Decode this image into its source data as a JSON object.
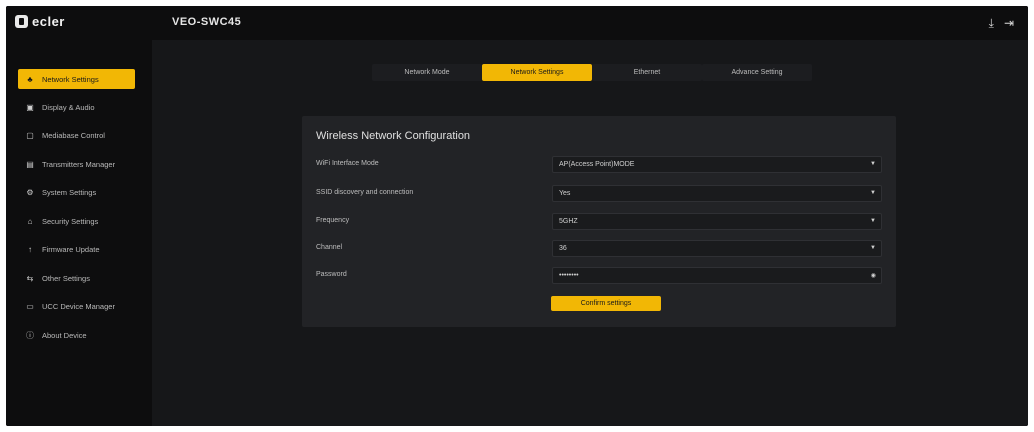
{
  "brand": {
    "logo_text": "ecler"
  },
  "header": {
    "device_name": "VEO-SWC45",
    "icons": [
      "download-icon",
      "logout-icon"
    ]
  },
  "sidebar": {
    "items": [
      {
        "label": "Network Settings",
        "icon": "network-icon"
      },
      {
        "label": "Display & Audio",
        "icon": "display-icon"
      },
      {
        "label": "Mediabase Control",
        "icon": "monitor-icon"
      },
      {
        "label": "Transmitters Manager",
        "icon": "transmitter-icon"
      },
      {
        "label": "System Settings",
        "icon": "gear-icon"
      },
      {
        "label": "Security Settings",
        "icon": "lock-icon"
      },
      {
        "label": "Firmware Update",
        "icon": "upload-icon"
      },
      {
        "label": "Other Settings",
        "icon": "sliders-icon"
      },
      {
        "label": "UCC Device Manager",
        "icon": "device-icon"
      },
      {
        "label": "About Device",
        "icon": "info-icon"
      }
    ]
  },
  "tabs": [
    {
      "label": "Network Mode"
    },
    {
      "label": "Network Settings"
    },
    {
      "label": "Ethernet"
    },
    {
      "label": "Advance Setting"
    }
  ],
  "panel": {
    "title": "Wireless Network Configuration",
    "rows": [
      {
        "label": "WiFi Interface Mode",
        "value": "AP(Access Point)MODE"
      },
      {
        "label": "SSID discovery and connection",
        "value": "Yes"
      },
      {
        "label": "Frequency",
        "value": "5GHZ"
      },
      {
        "label": "Channel",
        "value": "36"
      },
      {
        "label": "Password",
        "value": "••••••••"
      }
    ],
    "save_label": "Confirm settings"
  },
  "colors": {
    "accent": "#f2b705",
    "background": "#111214",
    "panel": "#222326"
  }
}
